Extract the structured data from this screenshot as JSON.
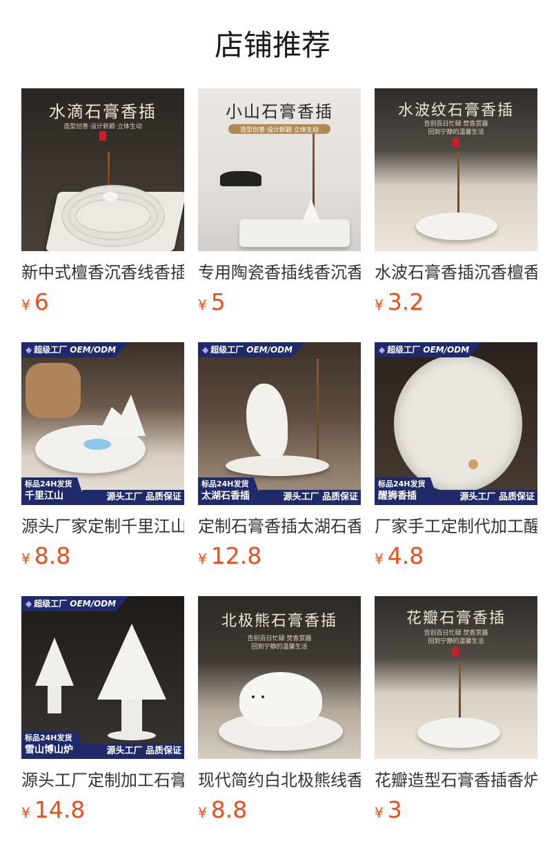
{
  "section": {
    "title": "店铺推荐"
  },
  "currency": "¥",
  "items": [
    {
      "name": "新中式檀香沉香线香插",
      "price": "6",
      "thumb_title": "水滴石膏香插",
      "thumb_sub": "造型创意·设计新颖·立体生动",
      "badge": false
    },
    {
      "name": "专用陶瓷香插线香沉香",
      "price": "5",
      "thumb_title": "小山石膏香插",
      "thumb_sub": "造型创意·设计新颖·立体生动",
      "badge": false
    },
    {
      "name": "水波石膏香插沉香檀香",
      "price": "3.2",
      "thumb_title": "水波纹石膏香插",
      "thumb_sub": "告别百日忙碌 焚香赏器",
      "thumb_sub2": "回到宁静的温馨生活",
      "badge": false
    },
    {
      "name": "源头厂家定制千里江山",
      "price": "8.8",
      "badge": true,
      "badge_top": "超级工厂",
      "badge_oem": "OEM/ODM",
      "band_line1": "标品24H发货",
      "band_line2": "千里江山",
      "band_right": "源头工厂 品质保证"
    },
    {
      "name": "定制石膏香插太湖石香",
      "price": "12.8",
      "badge": true,
      "badge_top": "超级工厂",
      "badge_oem": "OEM/ODM",
      "band_line1": "标品24H发货",
      "band_line2": "太湖石香插",
      "band_right": "源头工厂 品质保证"
    },
    {
      "name": "厂家手工定制代加工醒",
      "price": "4.8",
      "badge": true,
      "badge_top": "超级工厂",
      "badge_oem": "OEM/ODM",
      "band_line1": "标品24H发货",
      "band_line2": "醒狮香插",
      "band_right": "源头工厂 品质保证"
    },
    {
      "name": "源头工厂定制加工石膏",
      "price": "14.8",
      "badge": true,
      "badge_top": "超级工厂",
      "badge_oem": "OEM/ODM",
      "band_line1": "标品24H发货",
      "band_line2": "雪山博山炉",
      "band_right": "源头工厂 品质保证"
    },
    {
      "name": "现代简约白北极熊线香",
      "price": "8.8",
      "thumb_title": "北极熊石膏香插",
      "thumb_sub": "告别百日忙碌 焚香赏器",
      "thumb_sub2": "回到宁静的温馨生活",
      "badge": false
    },
    {
      "name": "花瓣造型石膏香插香炉",
      "price": "3",
      "thumb_title": "花瓣石膏香插",
      "thumb_sub": "告别百日忙碌 焚香赏器",
      "thumb_sub2": "回到宁静的温馨生活",
      "badge": false
    }
  ]
}
